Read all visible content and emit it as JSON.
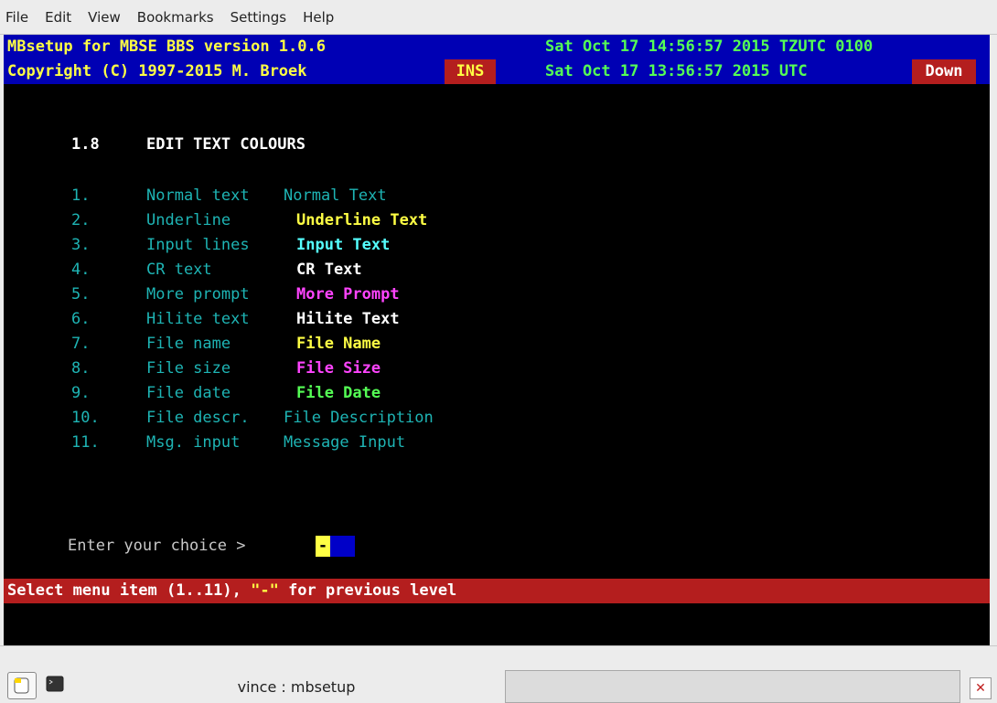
{
  "menubar": {
    "items": [
      "File",
      "Edit",
      "View",
      "Bookmarks",
      "Settings",
      "Help"
    ]
  },
  "header": {
    "left1": "MBsetup for MBSE BBS version 1.0.6",
    "right1": "Sat Oct 17 14:56:57 2015 TZUTC 0100",
    "left2": "Copyright (C) 1997-2015 M. Broek",
    "ins": "INS",
    "right2": "Sat Oct 17 13:56:57 2015 UTC",
    "down": "Down"
  },
  "section": {
    "number": "1.8",
    "title": "EDIT TEXT COLOURS"
  },
  "items": [
    {
      "num": "1.",
      "label": "Normal text",
      "sample": "Normal Text"
    },
    {
      "num": "2.",
      "label": "Underline",
      "sample": "Underline Text"
    },
    {
      "num": "3.",
      "label": "Input lines",
      "sample": "Input Text"
    },
    {
      "num": "4.",
      "label": "CR text",
      "sample": "CR Text"
    },
    {
      "num": "5.",
      "label": "More prompt",
      "sample": "More Prompt"
    },
    {
      "num": "6.",
      "label": "Hilite text",
      "sample": "Hilite Text"
    },
    {
      "num": "7.",
      "label": "File name",
      "sample": "File Name"
    },
    {
      "num": "8.",
      "label": "File size",
      "sample": "File Size"
    },
    {
      "num": "9.",
      "label": "File date",
      "sample": "File Date"
    },
    {
      "num": "10.",
      "label": "File descr.",
      "sample": "File Description"
    },
    {
      "num": "11.",
      "label": "Msg. input",
      "sample": "Message Input"
    }
  ],
  "prompt": {
    "text": "Enter your choice >",
    "value": "-"
  },
  "status": {
    "prefix": "Select menu item (1..11), ",
    "dash": "\"-\"",
    "suffix": " for previous level"
  },
  "taskbar": {
    "task_label": "vince : mbsetup"
  },
  "colors": {
    "header_bg": "#0000b4",
    "status_bg": "#b41e1e",
    "cyan": "#1eb4b4",
    "yellow": "#ffff44",
    "green": "#55ff55",
    "magenta": "#ff44ff"
  }
}
